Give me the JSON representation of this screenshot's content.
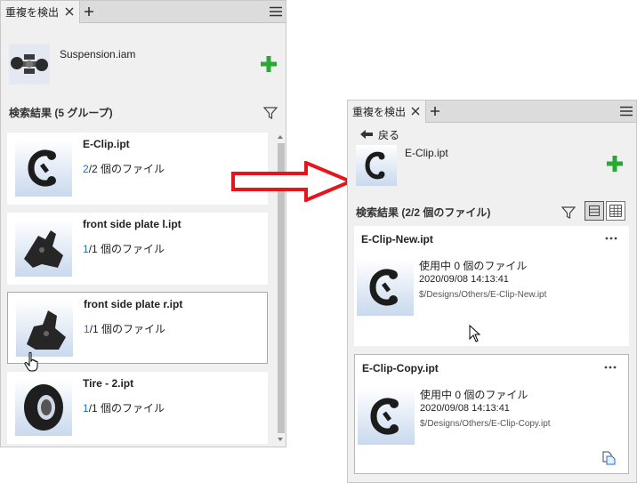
{
  "left": {
    "tab_label": "重複を検出",
    "assembly_name": "Suspension.iam",
    "results_title": "検索結果 (5 グループ)",
    "results": [
      {
        "name": "E-Clip.ipt",
        "found": "2",
        "total": "/2",
        "suffix": " 個のファイル",
        "thumb": "e-clip-icon"
      },
      {
        "name": "front side plate l.ipt",
        "found": "1",
        "total": "/1",
        "suffix": " 個のファイル",
        "thumb": "plate-left-icon"
      },
      {
        "name": "front side plate r.ipt",
        "found": "1",
        "total": "/1",
        "suffix": " 個のファイル",
        "thumb": "plate-right-icon"
      },
      {
        "name": "Tire - 2.ipt",
        "found": "1",
        "total": "/1",
        "suffix": " 個のファイル",
        "thumb": "tire-icon"
      }
    ]
  },
  "right": {
    "tab_label": "重複を検出",
    "back_label": "戻る",
    "file_name": "E-Clip.ipt",
    "results_title": "検索結果 (2/2 個のファイル)",
    "versions": [
      {
        "name": "E-Clip-New.ipt",
        "usage": "使用中 0 個のファイル",
        "date": "2020/09/08 14:13:41",
        "path": "$/Designs/Others/E-Clip-New.ipt"
      },
      {
        "name": "E-Clip-Copy.ipt",
        "usage": "使用中 0 個のファイル",
        "date": "2020/09/08 14:13:41",
        "path": "$/Designs/Others/E-Clip-Copy.ipt"
      }
    ]
  },
  "colors": {
    "add_green": "#2aa836",
    "count_blue": "#1f6fd1",
    "arrow_red": "#e8141b",
    "panel_bg": "#f0f0f0"
  },
  "icons": {
    "close": "close-icon",
    "add_tab": "add-tab-icon",
    "menu": "menu-icon",
    "add": "plus-icon",
    "filter": "filter-icon",
    "back": "back-arrow-icon",
    "more": "more-icon",
    "document": "document-icon"
  }
}
